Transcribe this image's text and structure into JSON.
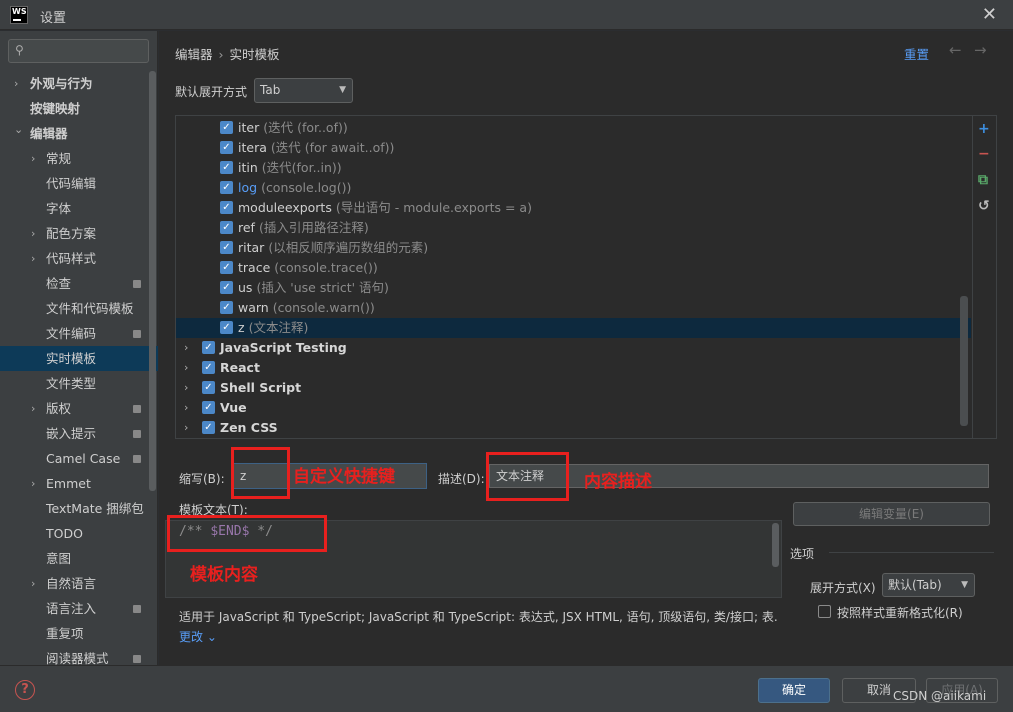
{
  "window": {
    "title": "设置",
    "app_logo": "WS",
    "close_glyph": "✕"
  },
  "sidebar": {
    "items": [
      {
        "label": "外观与行为",
        "expandable": true,
        "bold": true,
        "level": 0
      },
      {
        "label": "按键映射",
        "expandable": false,
        "bold": true,
        "level": 0
      },
      {
        "label": "编辑器",
        "expandable": true,
        "expanded": true,
        "bold": true,
        "level": 0
      },
      {
        "label": "常规",
        "expandable": true,
        "level": 1
      },
      {
        "label": "代码编辑",
        "level": 2
      },
      {
        "label": "字体",
        "level": 2
      },
      {
        "label": "配色方案",
        "expandable": true,
        "level": 1
      },
      {
        "label": "代码样式",
        "expandable": true,
        "level": 1
      },
      {
        "label": "检查",
        "level": 2,
        "badge": true
      },
      {
        "label": "文件和代码模板",
        "level": 2
      },
      {
        "label": "文件编码",
        "level": 2,
        "badge": true
      },
      {
        "label": "实时模板",
        "level": 2,
        "selected": true
      },
      {
        "label": "文件类型",
        "level": 2
      },
      {
        "label": "版权",
        "expandable": true,
        "level": 1,
        "badge": true
      },
      {
        "label": "嵌入提示",
        "level": 2,
        "badge": true
      },
      {
        "label": "Camel Case",
        "level": 2,
        "badge": true
      },
      {
        "label": "Emmet",
        "expandable": true,
        "level": 1
      },
      {
        "label": "TextMate 捆绑包",
        "level": 2
      },
      {
        "label": "TODO",
        "level": 2
      },
      {
        "label": "意图",
        "level": 2
      },
      {
        "label": "自然语言",
        "expandable": true,
        "level": 1
      },
      {
        "label": "语言注入",
        "level": 2,
        "badge": true
      },
      {
        "label": "重复项",
        "level": 2
      },
      {
        "label": "阅读器模式",
        "level": 2,
        "badge": true
      }
    ]
  },
  "header": {
    "crumb1": "编辑器",
    "crumb_sep": "›",
    "crumb2": "实时模板",
    "reset": "重置",
    "back": "←",
    "forward": "→"
  },
  "expand_default": {
    "label": "默认展开方式",
    "value": "Tab"
  },
  "templates": [
    {
      "name": "iter",
      "desc": "(迭代 (for..of))",
      "level": 1
    },
    {
      "name": "itera",
      "desc": "(迭代 (for await..of))",
      "level": 1
    },
    {
      "name": "itin",
      "desc": "(迭代(for..in))",
      "level": 1
    },
    {
      "name": "log",
      "desc": "(console.log())",
      "level": 1,
      "highlight": true
    },
    {
      "name": "moduleexports",
      "desc": "(导出语句 - module.exports = a)",
      "level": 1
    },
    {
      "name": "ref",
      "desc": "(插入引用路径注释)",
      "level": 1
    },
    {
      "name": "ritar",
      "desc": "(以相反顺序遍历数组的元素)",
      "level": 1
    },
    {
      "name": "trace",
      "desc": "(console.trace())",
      "level": 1
    },
    {
      "name": "us",
      "desc": "(插入 'use strict' 语句)",
      "level": 1
    },
    {
      "name": "warn",
      "desc": "(console.warn())",
      "level": 1
    },
    {
      "name": "z",
      "desc": "(文本注释)",
      "level": 1,
      "selected": true
    },
    {
      "name": "JavaScript Testing",
      "desc": "",
      "level": 0
    },
    {
      "name": "React",
      "desc": "",
      "level": 0
    },
    {
      "name": "Shell Script",
      "desc": "",
      "level": 0
    },
    {
      "name": "Vue",
      "desc": "",
      "level": 0
    },
    {
      "name": "Zen CSS",
      "desc": "",
      "level": 0
    }
  ],
  "toolbar": {
    "add": "+",
    "remove": "−",
    "copy": "⧉",
    "restore": "↺"
  },
  "abbr": {
    "label": "缩写(B):",
    "value": "z"
  },
  "desc": {
    "label": "描述(D):",
    "value": "文本注释"
  },
  "template_text": {
    "label": "模板文本(T):",
    "comment_open": "/**",
    "variable": "$END$",
    "comment_close": "*/"
  },
  "edit_vars_button": "编辑变量(E)",
  "options": {
    "title": "选项",
    "expand_label": "展开方式(X)",
    "expand_value": "默认(Tab)",
    "reformat_label": "按照样式重新格式化(R)"
  },
  "applies_to": "适用于 JavaScript 和 TypeScript; JavaScript 和 TypeScript: 表达式, JSX HTML, 语句, 顶级语句, 类/接口; 表...",
  "more": "更改 ⌄",
  "annotations": {
    "shortcut": "自定义快捷键",
    "content_desc": "内容描述",
    "template_content": "模板内容"
  },
  "footer": {
    "ok": "确定",
    "cancel": "取消",
    "apply": "应用(A)",
    "watermark": "CSDN @aiikami"
  },
  "colors": {
    "accent": "#589df6",
    "selection": "#0d3a58",
    "annotation_red": "#e8201e",
    "checkbox": "#4c88c8"
  }
}
